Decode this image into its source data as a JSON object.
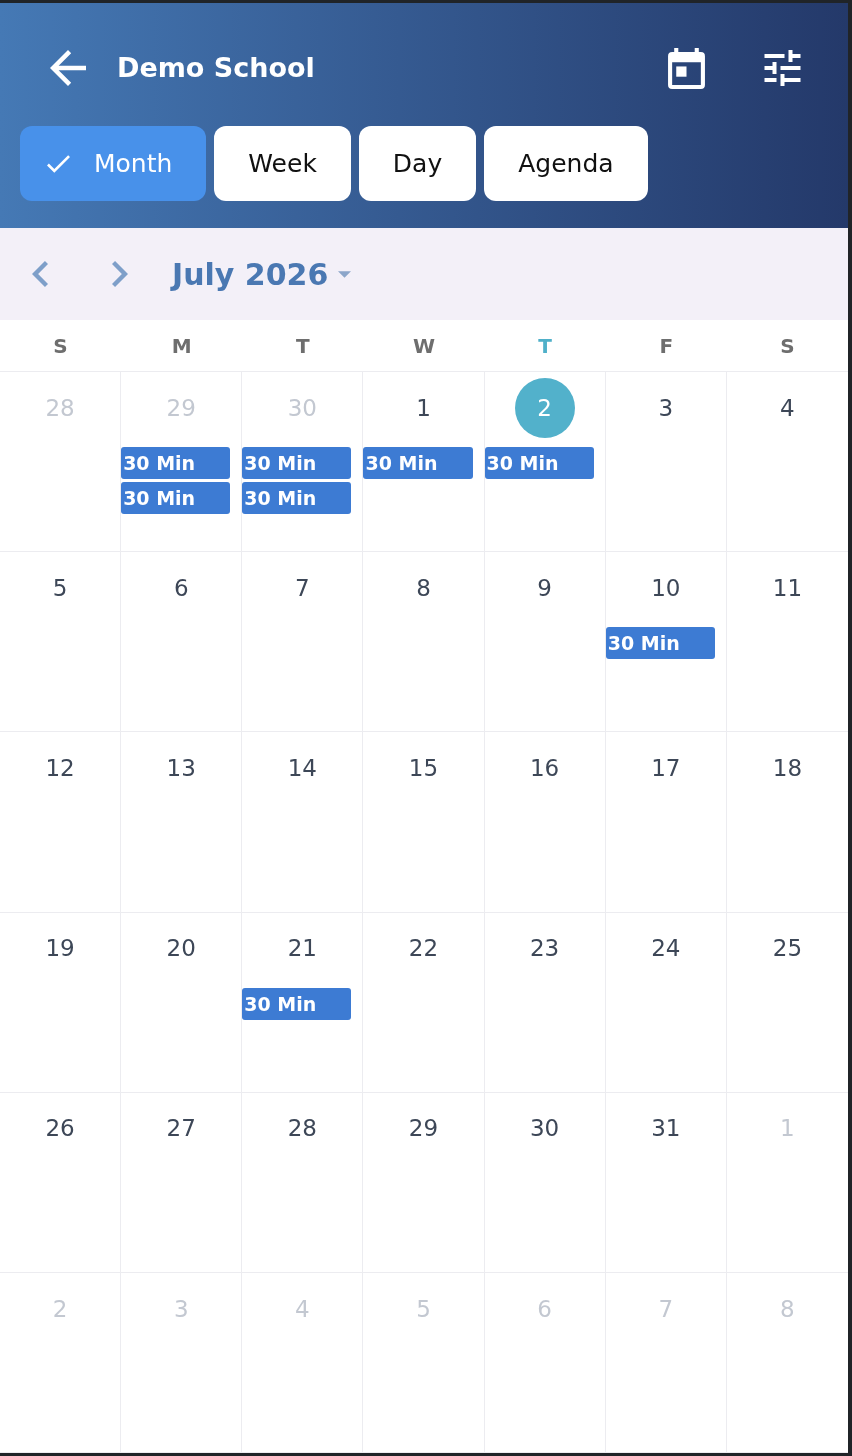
{
  "header": {
    "title": "Demo School"
  },
  "view_tabs": [
    {
      "label": "Month",
      "selected": true
    },
    {
      "label": "Week",
      "selected": false
    },
    {
      "label": "Day",
      "selected": false
    },
    {
      "label": "Agenda",
      "selected": false
    }
  ],
  "month_nav": {
    "title": "July 2026"
  },
  "weekdays": [
    {
      "label": "S",
      "current": false
    },
    {
      "label": "M",
      "current": false
    },
    {
      "label": "T",
      "current": false
    },
    {
      "label": "W",
      "current": false
    },
    {
      "label": "T",
      "current": true
    },
    {
      "label": "F",
      "current": false
    },
    {
      "label": "S",
      "current": false
    }
  ],
  "weeks": [
    {
      "days": [
        {
          "label": "28",
          "in_month": false,
          "today": false
        },
        {
          "label": "29",
          "in_month": false,
          "today": false,
          "events": [
            "30 Min",
            "30 Min"
          ]
        },
        {
          "label": "30",
          "in_month": false,
          "today": false,
          "events": [
            "30 Min",
            "30 Min"
          ]
        },
        {
          "label": "1",
          "in_month": true,
          "today": false,
          "events": [
            "30 Min"
          ]
        },
        {
          "label": "2",
          "in_month": true,
          "today": true,
          "events": [
            "30 Min"
          ]
        },
        {
          "label": "3",
          "in_month": true,
          "today": false
        },
        {
          "label": "4",
          "in_month": true,
          "today": false
        }
      ]
    },
    {
      "days": [
        {
          "label": "5",
          "in_month": true,
          "today": false
        },
        {
          "label": "6",
          "in_month": true,
          "today": false
        },
        {
          "label": "7",
          "in_month": true,
          "today": false
        },
        {
          "label": "8",
          "in_month": true,
          "today": false
        },
        {
          "label": "9",
          "in_month": true,
          "today": false
        },
        {
          "label": "10",
          "in_month": true,
          "today": false,
          "events": [
            "30 Min"
          ]
        },
        {
          "label": "11",
          "in_month": true,
          "today": false
        }
      ]
    },
    {
      "days": [
        {
          "label": "12",
          "in_month": true,
          "today": false
        },
        {
          "label": "13",
          "in_month": true,
          "today": false
        },
        {
          "label": "14",
          "in_month": true,
          "today": false
        },
        {
          "label": "15",
          "in_month": true,
          "today": false
        },
        {
          "label": "16",
          "in_month": true,
          "today": false
        },
        {
          "label": "17",
          "in_month": true,
          "today": false
        },
        {
          "label": "18",
          "in_month": true,
          "today": false
        }
      ]
    },
    {
      "days": [
        {
          "label": "19",
          "in_month": true,
          "today": false
        },
        {
          "label": "20",
          "in_month": true,
          "today": false
        },
        {
          "label": "21",
          "in_month": true,
          "today": false,
          "events": [
            "30 Min"
          ]
        },
        {
          "label": "22",
          "in_month": true,
          "today": false
        },
        {
          "label": "23",
          "in_month": true,
          "today": false
        },
        {
          "label": "24",
          "in_month": true,
          "today": false
        },
        {
          "label": "25",
          "in_month": true,
          "today": false
        }
      ]
    },
    {
      "days": [
        {
          "label": "26",
          "in_month": true,
          "today": false
        },
        {
          "label": "27",
          "in_month": true,
          "today": false
        },
        {
          "label": "28",
          "in_month": true,
          "today": false
        },
        {
          "label": "29",
          "in_month": true,
          "today": false
        },
        {
          "label": "30",
          "in_month": true,
          "today": false
        },
        {
          "label": "31",
          "in_month": true,
          "today": false
        },
        {
          "label": "1",
          "in_month": false,
          "today": false
        }
      ]
    },
    {
      "days": [
        {
          "label": "2",
          "in_month": false,
          "today": false
        },
        {
          "label": "3",
          "in_month": false,
          "today": false
        },
        {
          "label": "4",
          "in_month": false,
          "today": false
        },
        {
          "label": "5",
          "in_month": false,
          "today": false
        },
        {
          "label": "6",
          "in_month": false,
          "today": false
        },
        {
          "label": "7",
          "in_month": false,
          "today": false
        },
        {
          "label": "8",
          "in_month": false,
          "today": false
        }
      ]
    }
  ]
}
